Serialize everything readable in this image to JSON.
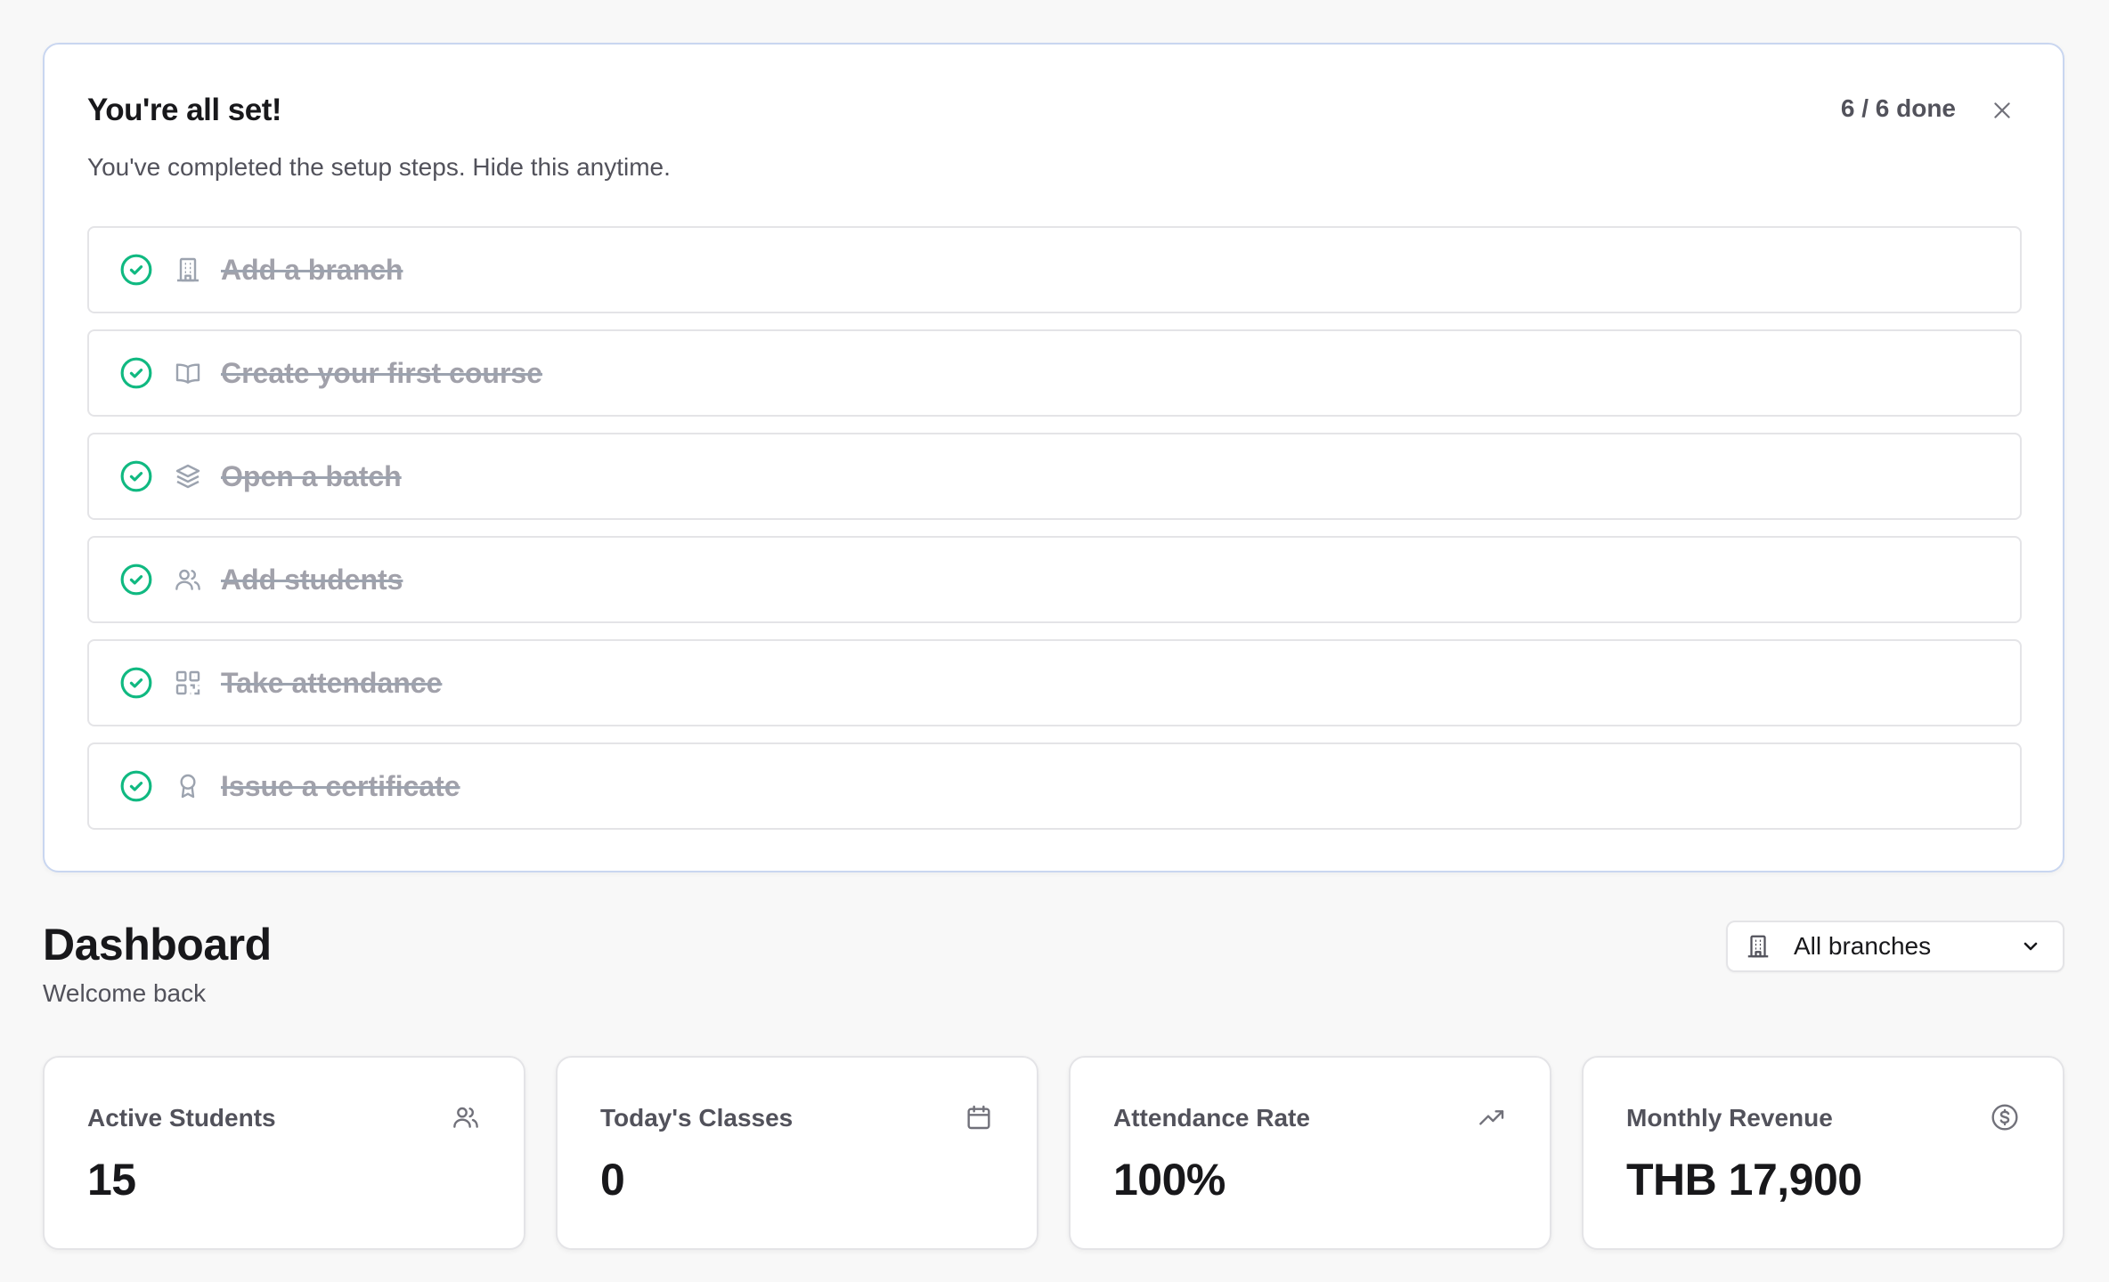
{
  "setup": {
    "title": "You're all set!",
    "subtitle": "You've completed the setup steps. Hide this anytime.",
    "progress_text": "6 / 6 done",
    "steps": [
      {
        "label": "Add a branch",
        "icon": "building-icon",
        "done": true
      },
      {
        "label": "Create your first course",
        "icon": "book-open-icon",
        "done": true
      },
      {
        "label": "Open a batch",
        "icon": "layers-icon",
        "done": true
      },
      {
        "label": "Add students",
        "icon": "users-icon",
        "done": true
      },
      {
        "label": "Take attendance",
        "icon": "qr-code-icon",
        "done": true
      },
      {
        "label": "Issue a certificate",
        "icon": "award-icon",
        "done": true
      }
    ]
  },
  "dashboard": {
    "title": "Dashboard",
    "subtitle": "Welcome back",
    "branch_filter": {
      "selected": "All branches",
      "icon": "building-icon"
    }
  },
  "stats": [
    {
      "label": "Active Students",
      "value": "15",
      "icon": "users-icon"
    },
    {
      "label": "Today's Classes",
      "value": "0",
      "icon": "calendar-icon"
    },
    {
      "label": "Attendance Rate",
      "value": "100%",
      "icon": "trending-up-icon"
    },
    {
      "label": "Monthly Revenue",
      "value": "THB 17,900",
      "icon": "dollar-circle-icon"
    }
  ],
  "colors": {
    "success": "#10b981",
    "muted_text": "#a1a1aa",
    "card_border_accent": "#c9d6f0"
  }
}
